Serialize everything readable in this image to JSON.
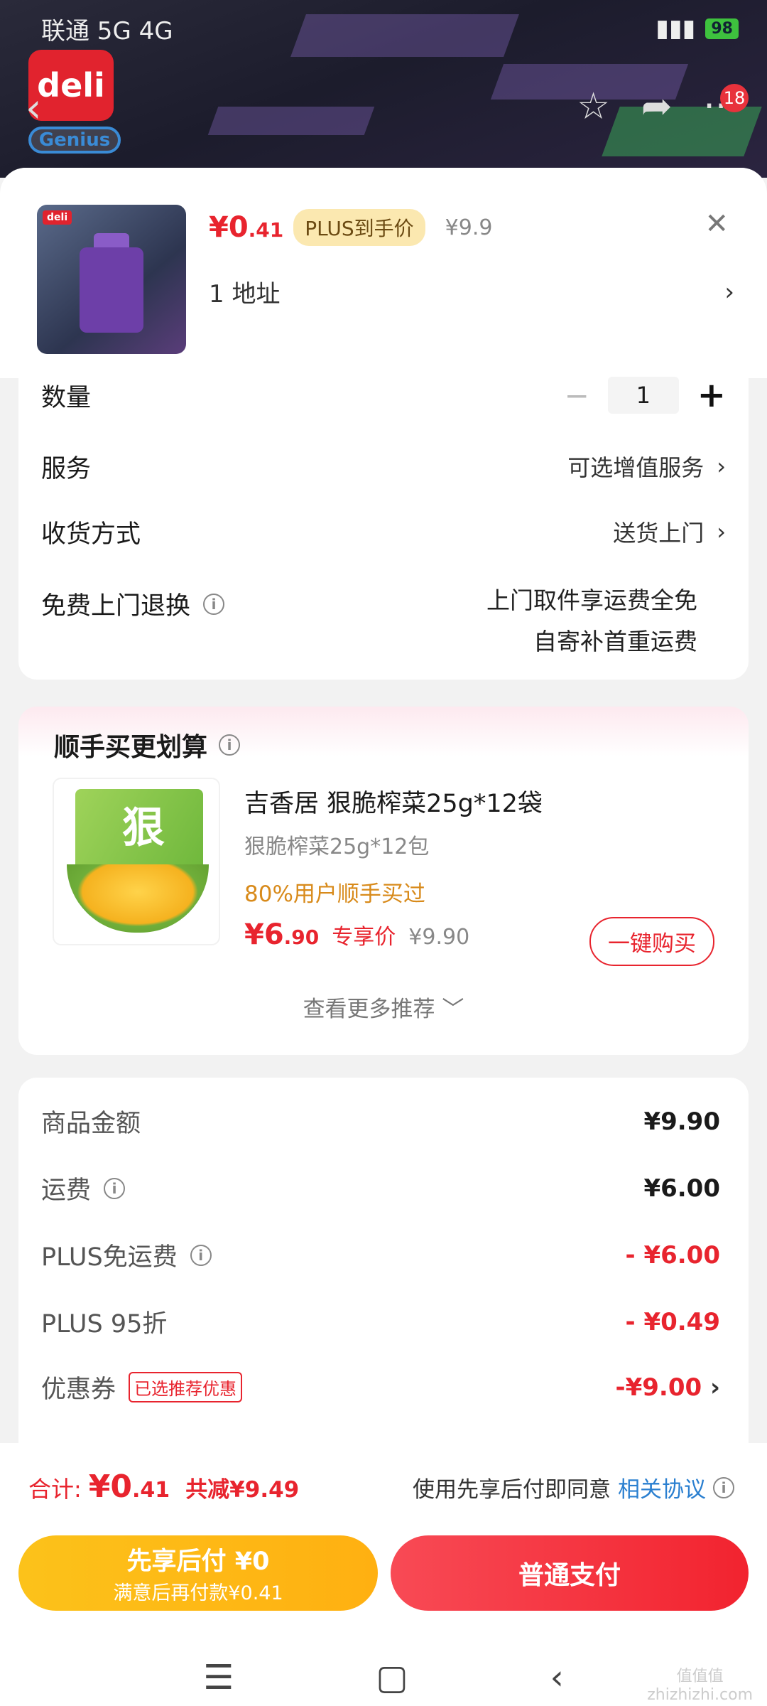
{
  "status_bar": {
    "carrier": "联通 5G 4G",
    "battery": "98"
  },
  "brand": {
    "logo_top": "deli",
    "logo_bottom": "Genius"
  },
  "nav": {
    "badge_count": "18"
  },
  "sheet": {
    "price_main": "¥0",
    "price_decimal": ".41",
    "plus_tag": "PLUS到手价",
    "price_original": "¥9.9",
    "address_count": "1",
    "address_label": "地址",
    "thumb_logo": "deli"
  },
  "options": {
    "quantity_label": "数量",
    "quantity_value": "1",
    "service_label": "服务",
    "service_value": "可选增值服务",
    "delivery_label": "收货方式",
    "delivery_value": "送货上门",
    "return_label": "免费上门退换",
    "return_value_1": "上门取件享运费全免",
    "return_value_2": "自寄补首重运费"
  },
  "recommend": {
    "title": "顺手买更划算",
    "product_name": "吉香居 狠脆榨菜25g*12袋",
    "product_spec": "狠脆榨菜25g*12包",
    "product_tag": "80%用户顺手买过",
    "product_price_main": "¥6",
    "product_price_decimal": ".90",
    "product_price_tag": "专享价",
    "product_price_original": "¥9.90",
    "buy_button": "一键购买",
    "see_more": "查看更多推荐 ﹀",
    "pack_char": "狠"
  },
  "fees": {
    "goods_label": "商品金额",
    "goods_value": "¥9.90",
    "shipping_label": "运费",
    "shipping_value": "¥6.00",
    "plus_ship_label": "PLUS免运费",
    "plus_ship_value": "- ¥6.00",
    "plus_discount_label": "PLUS 95折",
    "plus_discount_value": "- ¥0.49",
    "coupon_label": "优惠券",
    "coupon_chip": "已选推荐优惠",
    "coupon_value": "-¥9.00"
  },
  "bottom": {
    "total_label": "合计:",
    "total_main": "¥0",
    "total_decimal": ".41",
    "total_discount": "共减¥9.49",
    "agree_text": "使用先享后付即同意",
    "agree_link": "相关协议",
    "later_title": "先享后付 ¥0",
    "later_sub": "满意后再付款¥0.41",
    "pay_button": "普通支付"
  },
  "watermark": {
    "line1": "值值值",
    "line2": "zhizhizhi.com"
  },
  "colors": {
    "accent_red": "#e8242e",
    "plus_gold": "#fbe8b0",
    "pay_later_yellow": "#fcc21a",
    "link_blue": "#2a7fd0"
  }
}
